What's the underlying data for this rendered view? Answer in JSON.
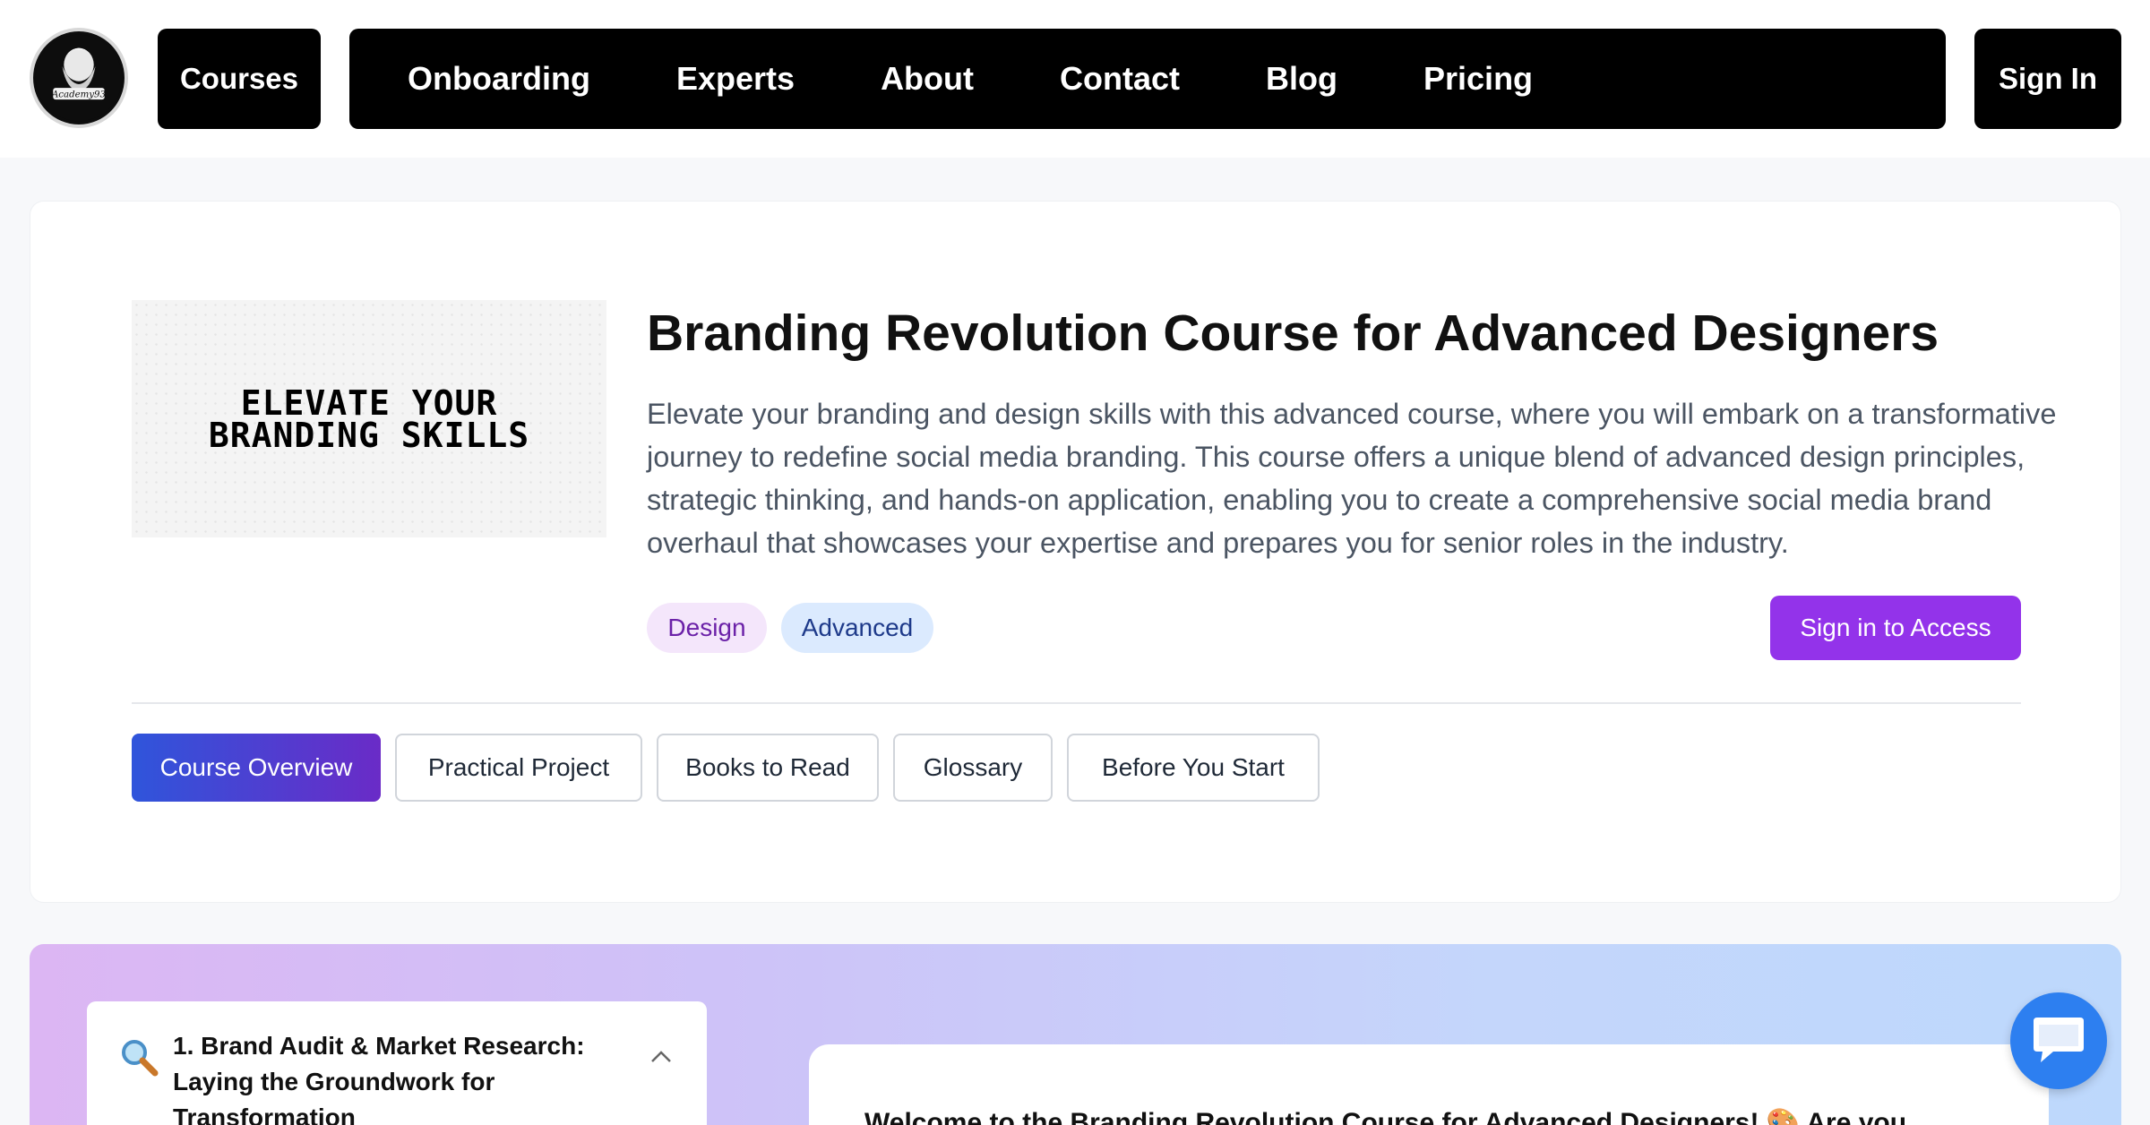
{
  "header": {
    "logo_text": "Academy93",
    "courses_label": "Courses",
    "nav_items": [
      "Onboarding",
      "Experts",
      "About",
      "Contact",
      "Blog",
      "Pricing"
    ],
    "sign_in_label": "Sign In"
  },
  "course": {
    "thumbnail_text_line1": "ELEVATE YOUR",
    "thumbnail_text_line2": "BRANDING SKILLS",
    "title": "Branding Revolution Course for Advanced Designers",
    "description": "Elevate your branding and design skills with this advanced course, where you will embark on a transformative journey to redefine social media branding. This course offers a unique blend of advanced design principles, strategic thinking, and hands-on application, enabling you to create a comprehensive social media brand overhaul that showcases your expertise and prepares you for senior roles in the industry.",
    "tags": [
      "Design",
      "Advanced"
    ],
    "access_button": "Sign in to Access"
  },
  "tabs": [
    "Course Overview",
    "Practical Project",
    "Books to Read",
    "Glossary",
    "Before You Start"
  ],
  "active_tab": "Course Overview",
  "module": {
    "icon": "magnifier-icon",
    "title": "1. Brand Audit & Market Research: Laying the Groundwork for Transformation"
  },
  "welcome": {
    "text": "Welcome to the Branding Revolution Course for Advanced Designers! 🎨 Are you"
  },
  "colors": {
    "accent_purple": "#9333ea",
    "tab_gradient_start": "#2f55db",
    "tab_gradient_end": "#6a2bc7",
    "chat_blue": "#2d7ff0"
  }
}
